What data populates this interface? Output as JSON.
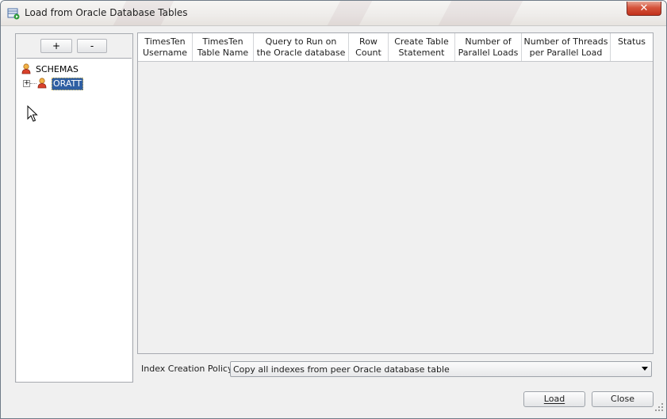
{
  "window": {
    "title": "Load from Oracle Database Tables",
    "close_label": "✕"
  },
  "tree_toolbar": {
    "add_label": "+",
    "remove_label": "-"
  },
  "tree": {
    "root_label": "SCHEMAS",
    "children": [
      {
        "label": "ORATT",
        "expander": "+"
      }
    ]
  },
  "table": {
    "columns": [
      {
        "line1": "TimesTen",
        "line2": "Username"
      },
      {
        "line1": "TimesTen",
        "line2": "Table Name"
      },
      {
        "line1": "Query to Run on",
        "line2": "the Oracle database"
      },
      {
        "line1": "Row",
        "line2": "Count"
      },
      {
        "line1": "Create Table",
        "line2": "Statement"
      },
      {
        "line1": "Number of",
        "line2": "Parallel Loads"
      },
      {
        "line1": "Number of Threads",
        "line2": "per Parallel Load"
      },
      {
        "line1": "Status",
        "line2": ""
      }
    ],
    "rows": []
  },
  "index_policy": {
    "label": "Index Creation Policy:",
    "selected": "Copy all indexes from peer Oracle database table"
  },
  "buttons": {
    "load": "Load",
    "close": "Close"
  },
  "colors": {
    "selection": "#2f5fa3",
    "close_button": "#c7432a"
  }
}
